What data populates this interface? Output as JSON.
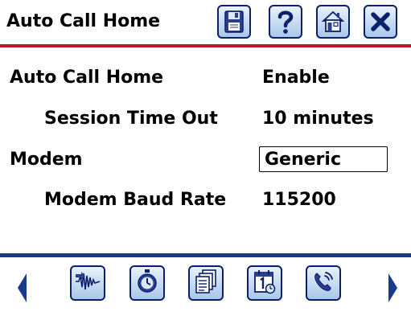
{
  "header": {
    "title": "Auto Call Home",
    "buttons": [
      {
        "name": "save",
        "icon": "floppy-disk-icon"
      },
      {
        "name": "help",
        "icon": "question-mark-icon"
      },
      {
        "name": "home",
        "icon": "house-icon"
      },
      {
        "name": "close",
        "icon": "x-close-icon"
      }
    ]
  },
  "settings": {
    "auto_call_home": {
      "label": "Auto Call Home",
      "value": "Enable"
    },
    "session_time_out": {
      "label": "Session Time Out",
      "value": "10 minutes"
    },
    "modem": {
      "label": "Modem",
      "value": "Generic"
    },
    "modem_baud_rate": {
      "label": "Modem Baud Rate",
      "value": "115200"
    }
  },
  "footer": {
    "buttons": [
      {
        "icon": "signal-wave-icon"
      },
      {
        "icon": "stopwatch-icon"
      },
      {
        "icon": "document-stack-icon"
      },
      {
        "icon": "calendar-clock-icon"
      },
      {
        "icon": "phone-call-icon"
      }
    ]
  },
  "colors": {
    "header_rule": "#c8102e",
    "footer_rule": "#1a3a8c",
    "button_border": "#0b1f6b",
    "icon_blue": "#1a3a8c"
  }
}
